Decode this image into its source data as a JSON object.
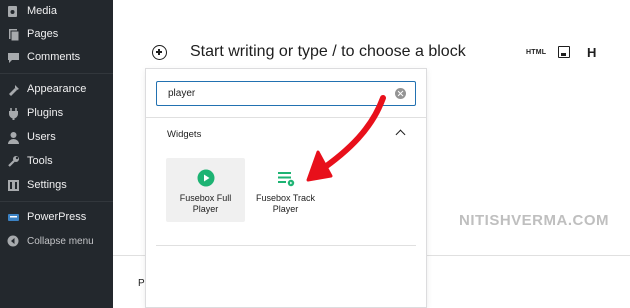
{
  "sidebar": {
    "items": [
      {
        "label": "Media",
        "icon": "media-icon"
      },
      {
        "label": "Pages",
        "icon": "pages-icon"
      },
      {
        "label": "Comments",
        "icon": "comments-icon"
      },
      {
        "label": "Appearance",
        "icon": "appearance-icon"
      },
      {
        "label": "Plugins",
        "icon": "plugins-icon"
      },
      {
        "label": "Users",
        "icon": "users-icon"
      },
      {
        "label": "Tools",
        "icon": "tools-icon"
      },
      {
        "label": "Settings",
        "icon": "settings-icon"
      },
      {
        "label": "PowerPress",
        "icon": "powerpress-icon"
      },
      {
        "label": "Collapse menu",
        "icon": "collapse-icon"
      }
    ]
  },
  "editor": {
    "placeholder": "Start writing or type / to choose a block",
    "toolbar": {
      "html_label": "HTML",
      "heading_label": "H"
    },
    "bottom_label": "P"
  },
  "inserter": {
    "search_value": "player",
    "section_title": "Widgets",
    "blocks": [
      {
        "label": "Fusebox Full Player",
        "icon": "play-circle-icon"
      },
      {
        "label": "Fusebox Track Player",
        "icon": "track-list-icon"
      }
    ]
  },
  "watermark": "NITISHVERMA.COM",
  "colors": {
    "sidebar_bg": "#23282d",
    "focus_blue": "#2271b1",
    "block_icon_green": "#1db373",
    "arrow_red": "#e8101b"
  }
}
